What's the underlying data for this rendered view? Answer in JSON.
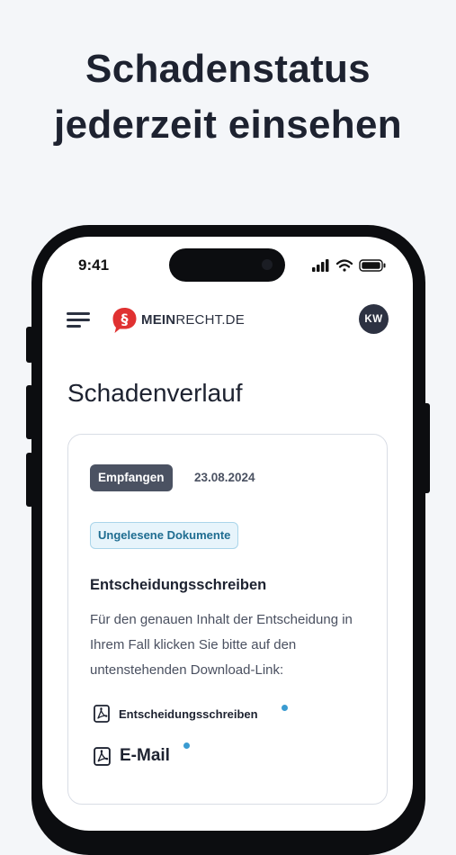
{
  "headline": {
    "line1": "Schadenstatus",
    "line2": "jederzeit einsehen"
  },
  "status_bar": {
    "time": "9:41"
  },
  "app_header": {
    "logo_bold": "MEIN",
    "logo_rest": "RECHT.DE",
    "logo_glyph": "§",
    "avatar_initials": "KW"
  },
  "page": {
    "title": "Schadenverlauf"
  },
  "card": {
    "status_badge": "Empfangen",
    "date": "23.08.2024",
    "unread_badge": "Ungelesene Dokumente",
    "doc_title": "Entscheidungsschreiben",
    "doc_body": "Für den genauen Inhalt der Entscheidung in Ihrem Fall klicken Sie bitte auf den untenstehenden Download-Link:",
    "downloads": [
      {
        "label": "Entscheidungsschreiben",
        "icon": "pdf-icon",
        "unread": true
      },
      {
        "label": "E-Mail",
        "icon": "pdf-icon",
        "unread": true
      }
    ]
  },
  "colors": {
    "brand_red": "#e03131",
    "dark": "#1d2230",
    "badge_dark": "#4b5262",
    "info_blue": "#3a9bd1"
  }
}
